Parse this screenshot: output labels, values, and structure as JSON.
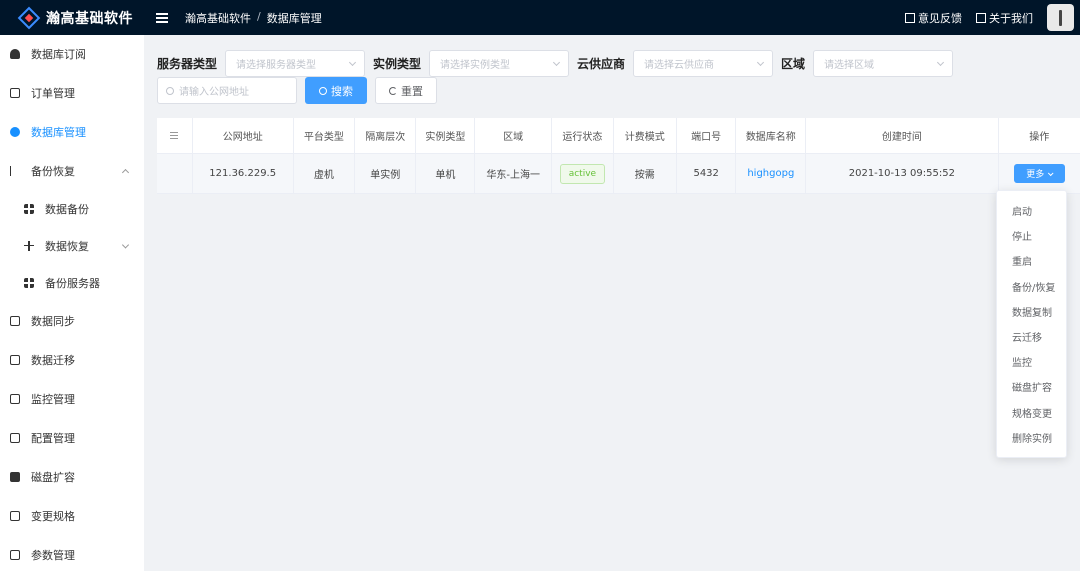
{
  "brand": {
    "name": "瀚高基础软件"
  },
  "breadcrumb": {
    "root": "瀚高基础软件",
    "separator": "/",
    "current": "数据库管理"
  },
  "topbar": {
    "feedback": "意见反馈",
    "about": "关于我们"
  },
  "sidebar": {
    "items": [
      {
        "label": "数据库订阅",
        "icon": "dashboard-icon"
      },
      {
        "label": "订单管理",
        "icon": "order-icon"
      },
      {
        "label": "数据库管理",
        "icon": "database-icon",
        "active": true
      },
      {
        "label": "备份恢复",
        "icon": "backup-icon",
        "expanded": true
      },
      {
        "label": "数据备份",
        "icon": "grid-icon",
        "sub": true
      },
      {
        "label": "数据恢复",
        "icon": "move-icon",
        "sub": true
      },
      {
        "label": "备份服务器",
        "icon": "server-grid-icon",
        "sub": true
      },
      {
        "label": "数据同步",
        "icon": "sync-icon"
      },
      {
        "label": "数据迁移",
        "icon": "migrate-icon"
      },
      {
        "label": "监控管理",
        "icon": "monitor-icon"
      },
      {
        "label": "配置管理",
        "icon": "config-icon"
      },
      {
        "label": "磁盘扩容",
        "icon": "disk-icon"
      },
      {
        "label": "变更规格",
        "icon": "spec-icon"
      },
      {
        "label": "参数管理",
        "icon": "folder-icon"
      }
    ]
  },
  "filters": {
    "server_type": {
      "label": "服务器类型",
      "placeholder": "请选择服务器类型"
    },
    "instance_type": {
      "label": "实例类型",
      "placeholder": "请选择实例类型"
    },
    "cloud_provider": {
      "label": "云供应商",
      "placeholder": "请选择云供应商"
    },
    "region": {
      "label": "区域",
      "placeholder": "请选择区域"
    },
    "ip_search": {
      "placeholder": "请输入公网地址"
    },
    "search_button": "搜索",
    "reset_button": "重置"
  },
  "table": {
    "headers": [
      "公网地址",
      "平台类型",
      "隔离层次",
      "实例类型",
      "区域",
      "运行状态",
      "计费模式",
      "端口号",
      "数据库名称",
      "创建时间",
      "操作"
    ],
    "rows": [
      {
        "public_ip": "121.36.229.5",
        "platform": "虚机",
        "isolation": "单实例",
        "instance_type": "单机",
        "region": "华东-上海一",
        "status": "active",
        "billing": "按需",
        "port": "5432",
        "db_name": "highgopg",
        "created": "2021-10-13 09:55:52",
        "action": "更多"
      }
    ]
  },
  "dropdown": {
    "items": [
      "启动",
      "停止",
      "重启",
      "备份/恢复",
      "数据复制",
      "云迁移",
      "监控",
      "磁盘扩容",
      "规格变更",
      "删除实例"
    ]
  },
  "colors": {
    "primary": "#409eff",
    "topbar": "#001529",
    "active": "#1890ff",
    "success": "#67c23a"
  }
}
